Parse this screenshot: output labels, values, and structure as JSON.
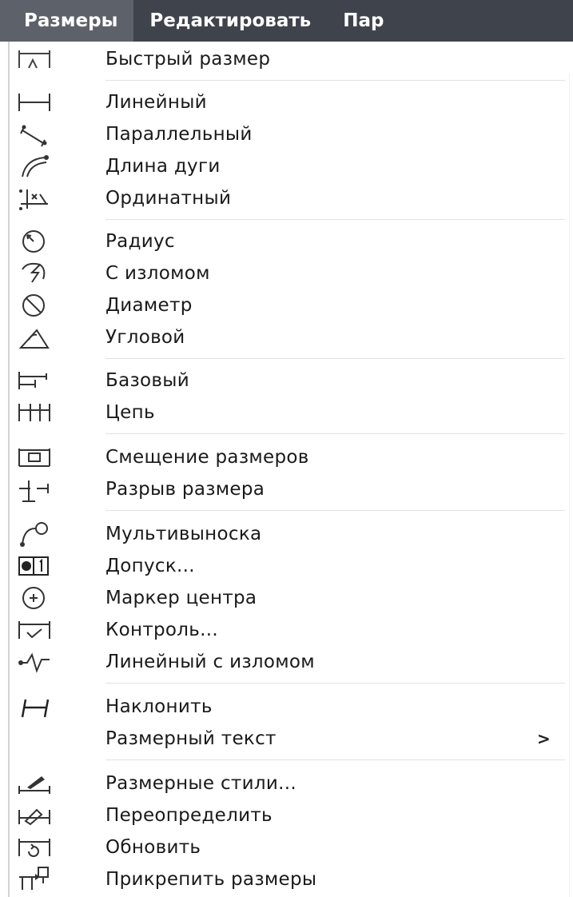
{
  "menubar": {
    "items": [
      {
        "label": "Размеры"
      },
      {
        "label": "Редактировать"
      },
      {
        "label": "Пар"
      }
    ]
  },
  "menu": {
    "items": [
      {
        "label": "Быстрый размер",
        "icon": "quick-dimension-icon"
      },
      {
        "label": "Линейный",
        "icon": "linear-dimension-icon"
      },
      {
        "label": "Параллельный",
        "icon": "aligned-dimension-icon"
      },
      {
        "label": "Длина дуги",
        "icon": "arc-length-icon"
      },
      {
        "label": "Ординатный",
        "icon": "ordinate-icon"
      },
      {
        "label": "Радиус",
        "icon": "radius-icon"
      },
      {
        "label": "С изломом",
        "icon": "jogged-radius-icon"
      },
      {
        "label": "Диаметр",
        "icon": "diameter-icon"
      },
      {
        "label": "Угловой",
        "icon": "angular-icon"
      },
      {
        "label": "Базовый",
        "icon": "baseline-icon"
      },
      {
        "label": "Цепь",
        "icon": "continue-icon"
      },
      {
        "label": "Смещение размеров",
        "icon": "dimension-space-icon"
      },
      {
        "label": "Разрыв размера",
        "icon": "dimension-break-icon"
      },
      {
        "label": "Мультивыноска",
        "icon": "multileader-icon"
      },
      {
        "label": "Допуск...",
        "icon": "tolerance-icon"
      },
      {
        "label": "Маркер центра",
        "icon": "center-mark-icon"
      },
      {
        "label": "Контроль...",
        "icon": "inspection-icon"
      },
      {
        "label": "Линейный с изломом",
        "icon": "jogged-linear-icon"
      },
      {
        "label": "Наклонить",
        "icon": "oblique-icon"
      },
      {
        "label": "Размерный текст",
        "submenu_arrow": ">"
      },
      {
        "label": "Размерные стили...",
        "icon": "dimension-style-icon"
      },
      {
        "label": "Переопределить",
        "icon": "override-icon"
      },
      {
        "label": "Обновить",
        "icon": "update-icon"
      },
      {
        "label": "Прикрепить размеры",
        "icon": "reassociate-icon"
      }
    ]
  }
}
